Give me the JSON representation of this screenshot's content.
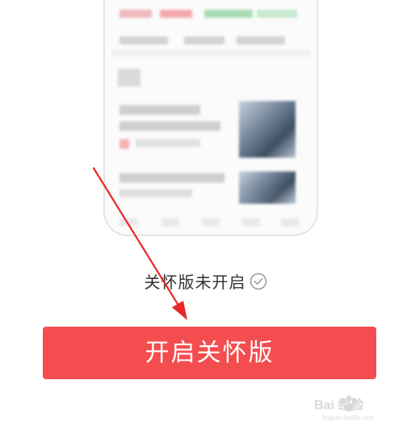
{
  "status": {
    "text": "关怀版未开启",
    "icon": "check-circle-icon"
  },
  "primary_button": {
    "label": "开启关怀版",
    "color": "#f44d4f"
  },
  "annotation": {
    "arrow_color": "#e8272b"
  },
  "watermark": {
    "logo_text": "Bai 经验",
    "url_text": "jingyan.baidu.com"
  }
}
